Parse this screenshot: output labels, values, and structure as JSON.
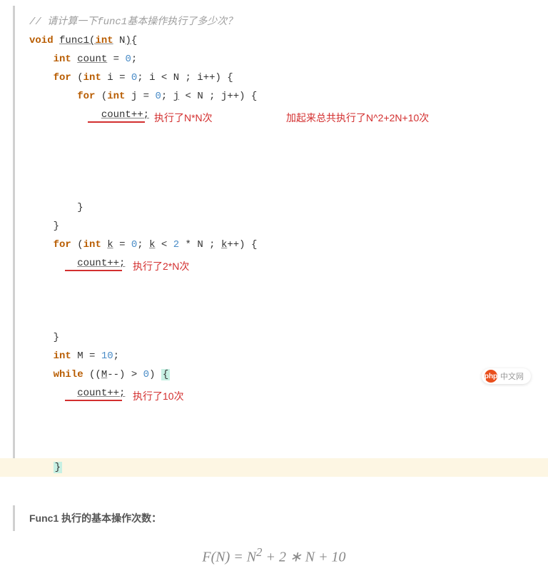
{
  "code": {
    "comment": "// 请计算一下func1基本操作执行了多少次？",
    "line2_void": "void",
    "line2_func": "func1",
    "line2_int": "int",
    "line2_param": " N",
    "line3_int": "int",
    "line3_var": "count",
    "line3_eq": " = ",
    "line3_zero": "0",
    "line4_for": "for",
    "line4_int": "int",
    "line4_i": "0",
    "line4_cond": "; i < N ; i++) {",
    "line5_for": "for",
    "line5_int": "int",
    "line5_j": "0",
    "line5_cond": "; ",
    "line5_jvar": "j",
    "line5_cond2": " < N ; j++) {",
    "line6_count": "count++;",
    "line7_brace": "}",
    "line8_brace": "}",
    "line9_for": "for",
    "line9_int": "int",
    "line9_k": "k",
    "line9_eq": " = ",
    "line9_zero": "0",
    "line9_cond": "; ",
    "line9_kvar": "k",
    "line9_cond2": " < ",
    "line9_two": "2",
    "line9_cond3": " * N ; ",
    "line9_kvar2": "k",
    "line9_cond4": "++) {",
    "line10_count": "count++;",
    "line11_brace": "}",
    "line12_int": "int",
    "line12_m": " M = ",
    "line12_ten": "10",
    "line13_while": "while",
    "line13_open": " ((",
    "line13_m": "M",
    "line13_cond": "--) > ",
    "line13_zero": "0",
    "line13_close": ") ",
    "line13_brace": "{",
    "line14_count": "count++;",
    "line15_brace": "}"
  },
  "annotations": {
    "a1": "执行了N*N次",
    "a2": "加起来总共执行了N^2+2N+10次",
    "a3": "执行了2*N次",
    "a4": "执行了10次"
  },
  "summary": {
    "title": "Func1 执行的基本操作次数：",
    "formula_left": "F(N) = N",
    "formula_sup": "2",
    "formula_right": " + 2 ∗ N + 10"
  },
  "logo": {
    "circle": "php",
    "text": "中文网"
  }
}
